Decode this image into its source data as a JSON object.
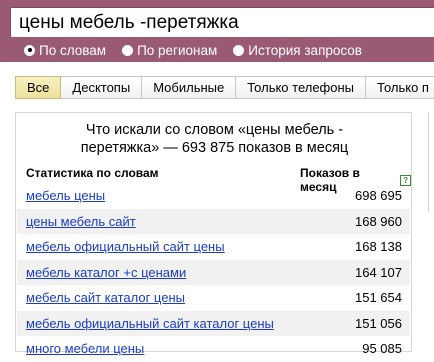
{
  "search": {
    "query": "цены мебель -перетяжка"
  },
  "radio_options": [
    {
      "label": "По словам",
      "checked": true
    },
    {
      "label": "По регионам",
      "checked": false
    },
    {
      "label": "История запросов",
      "checked": false
    }
  ],
  "tabs": [
    {
      "label": "Все",
      "active": true
    },
    {
      "label": "Десктопы",
      "active": false
    },
    {
      "label": "Мобильные",
      "active": false
    },
    {
      "label": "Только телефоны",
      "active": false
    },
    {
      "label": "Только п",
      "active": false
    }
  ],
  "panel": {
    "title_line1": "Что искали со словом «цены мебель -",
    "title_line2": "перетяжка» — 693 875 показов в месяц",
    "col_left": "Статистика по словам",
    "col_right": "Показов в месяц",
    "help_icon_glyph": "?",
    "rows": [
      {
        "phrase": "мебель цены",
        "count": "698 695"
      },
      {
        "phrase": "цены мебель сайт",
        "count": "168 960"
      },
      {
        "phrase": "мебель официальный сайт цены",
        "count": "168 138"
      },
      {
        "phrase": "мебель каталог +с ценами",
        "count": "164 107"
      },
      {
        "phrase": "мебель сайт каталог цены",
        "count": "151 654"
      },
      {
        "phrase": "мебель официальный сайт каталог цены",
        "count": "151 056"
      },
      {
        "phrase": "много мебели цены",
        "count": "95 085"
      }
    ]
  },
  "colors": {
    "header_bg": "#9a5a73",
    "link": "#1a3dc1",
    "active_tab": "#ece19a",
    "alt_row": "#f1f1f1"
  }
}
